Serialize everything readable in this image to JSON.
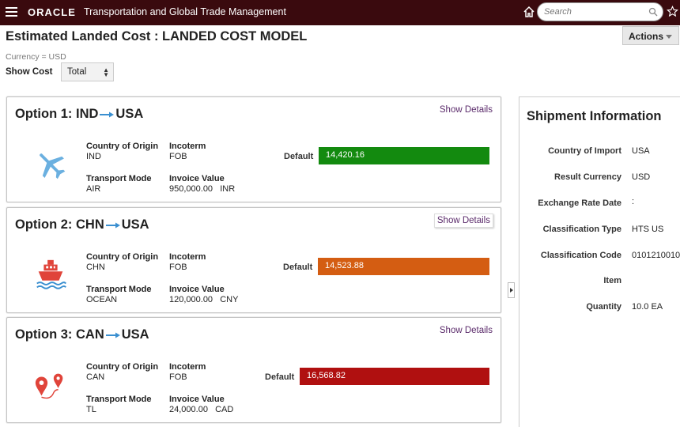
{
  "header": {
    "brand": "ORACLE",
    "app_name": "Transportation and Global Trade Management",
    "search_placeholder": "Search",
    "bg_color": "#3a0a0e"
  },
  "page": {
    "title": "Estimated Landed Cost : LANDED COST MODEL",
    "actions_label": "Actions",
    "currency": "Currency = USD",
    "show_cost_label": "Show Cost",
    "show_cost_value": "Total"
  },
  "options": [
    {
      "title": "Option 1: IND",
      "dest": "USA",
      "show_details": "Show Details",
      "icon": "airplane-icon",
      "origin_label": "Country of Origin",
      "origin": "IND",
      "incoterm_label": "Incoterm",
      "incoterm": "FOB",
      "mode_label": "Transport Mode",
      "mode": "AIR",
      "invoice_label": "Invoice Value",
      "invoice": "950,000.00   INR",
      "default_label": "Default",
      "cost": "14,420.16",
      "bar_color": "#138a0f"
    },
    {
      "title": "Option 2: CHN",
      "dest": "USA",
      "show_details": "Show Details",
      "icon": "ship-icon",
      "origin_label": "Country of Origin",
      "origin": "CHN",
      "incoterm_label": "Incoterm",
      "incoterm": "FOB",
      "mode_label": "Transport Mode",
      "mode": "OCEAN",
      "invoice_label": "Invoice Value",
      "invoice": "120,000.00   CNY",
      "default_label": "Default",
      "cost": "14,523.88",
      "bar_color": "#d45d12"
    },
    {
      "title": "Option 3: CAN",
      "dest": "USA",
      "show_details": "Show Details",
      "icon": "route-pins-icon",
      "origin_label": "Country of Origin",
      "origin": "CAN",
      "incoterm_label": "Incoterm",
      "incoterm": "FOB",
      "mode_label": "Transport Mode",
      "mode": "TL",
      "invoice_label": "Invoice Value",
      "invoice": "24,000.00   CAD",
      "default_label": "Default",
      "cost": "16,568.82",
      "bar_color": "#b01010"
    }
  ],
  "shipment": {
    "title": "Shipment Information",
    "rows": [
      {
        "label": "Country of Import",
        "value": "USA"
      },
      {
        "label": "Result Currency",
        "value": "USD"
      },
      {
        "label": "Exchange Rate Date",
        "value": ":"
      },
      {
        "label": "Classification Type",
        "value": "HTS US"
      },
      {
        "label": "Classification Code",
        "value": "0101210010"
      },
      {
        "label": "Item",
        "value": ""
      },
      {
        "label": "Quantity",
        "value": "10.0 EA"
      }
    ]
  }
}
